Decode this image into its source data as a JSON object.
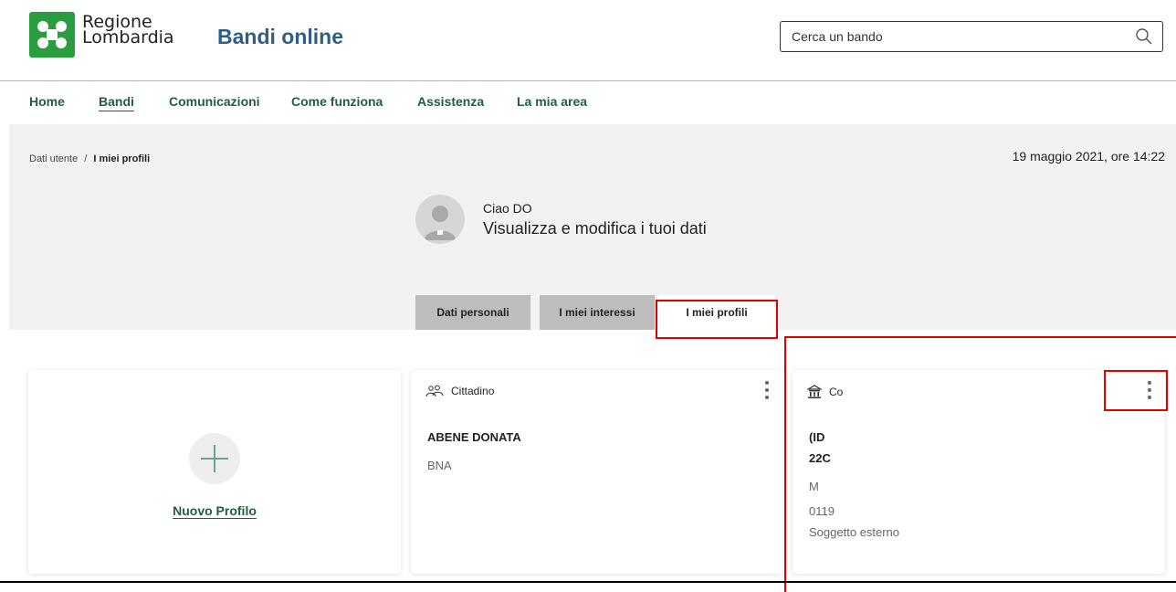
{
  "header": {
    "logo_line1": "Regione",
    "logo_line2": "Lombardia",
    "app_title": "Bandi online",
    "search_placeholder": "Cerca un bando"
  },
  "nav": {
    "items": [
      "Home",
      "Bandi",
      "Comunicazioni",
      "Come funziona",
      "Assistenza",
      "La mia area"
    ],
    "active": "Bandi"
  },
  "breadcrumb": {
    "parent": "Dati utente",
    "separator": "/",
    "current": "I miei profili"
  },
  "datetime": "19 maggio 2021, ore 14:22",
  "user": {
    "greeting": "Ciao DO",
    "subtitle": "Visualizza e modifica i tuoi dati"
  },
  "tabs": [
    {
      "label": "Dati personali",
      "active": false
    },
    {
      "label": "I miei interessi",
      "active": false
    },
    {
      "label": "I miei profili",
      "active": true
    }
  ],
  "cards": {
    "new_profile_label": "Nuovo Profilo",
    "cittadino": {
      "title": "Cittadino",
      "name": "ABENE DONATA",
      "code": "BNA"
    },
    "company": {
      "title": "Co",
      "line1": "(ID",
      "line2": "22C",
      "line3": "M",
      "line4": "0119",
      "line5": "Soggetto esterno"
    }
  },
  "colors": {
    "brand_green": "#2a9d3f",
    "nav_green": "#1f5e3e",
    "title_blue": "#2e5e8a",
    "highlight_red": "#e00000"
  }
}
